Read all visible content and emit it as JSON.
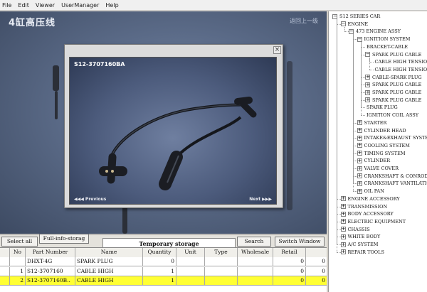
{
  "menu": [
    "File",
    "Edit",
    "Viewer",
    "UserManager",
    "Help"
  ],
  "viewer": {
    "title": "4缸高压线",
    "back_label": "返回上一级"
  },
  "popup": {
    "part_no": "S12-3707160BA",
    "prev_label": "◀◀◀ Previous",
    "next_label": "Next ▶▶▶",
    "close": "×"
  },
  "toolbar": {
    "select_all": "Select all",
    "full_info": "Full-info-storag",
    "storage_tab": "Temporary storage",
    "search": "Search",
    "switch_window": "Switch Window"
  },
  "table": {
    "headers": [
      "No",
      "Part Number",
      "Name",
      "Quantity",
      "Unit",
      "Type",
      "Wholesale",
      "Retail"
    ],
    "rows": [
      {
        "no": "",
        "part": "DHXT-4G",
        "name": "SPARK PLUG",
        "qty": "0",
        "unit": "",
        "type": "",
        "wholesale": "",
        "retail": "0"
      },
      {
        "no": "1",
        "part": "S12-3707160",
        "name": "CABLE HIGH",
        "qty": "1",
        "unit": "",
        "type": "",
        "wholesale": "",
        "retail": "0"
      },
      {
        "no": "2",
        "part": "S12-3707160B..",
        "name": "CABLE HIGH",
        "qty": "1",
        "unit": "",
        "type": "",
        "wholesale": "",
        "retail": "0"
      }
    ]
  },
  "tree": [
    {
      "label": "S12 SERIES CAR",
      "level": 0,
      "box": "−"
    },
    {
      "label": "ENGINE",
      "level": 1,
      "box": "−"
    },
    {
      "label": "473 ENGINE ASSY",
      "level": 2,
      "box": "−"
    },
    {
      "label": "IGNITION SYSTEM",
      "level": 3,
      "box": "−"
    },
    {
      "label": "BRACKET-CABLE",
      "level": 4,
      "box": ""
    },
    {
      "label": "SPARK PLUG CABLE",
      "level": 4,
      "box": "−"
    },
    {
      "label": "CABLE HIGH TENSION",
      "level": 5,
      "box": ""
    },
    {
      "label": "CABLE HIGH TENSION",
      "level": 5,
      "box": ""
    },
    {
      "label": "CABLE-SPARK PLUG",
      "level": 4,
      "box": "+"
    },
    {
      "label": "SPARK PLUG CABLE",
      "level": 4,
      "box": "+"
    },
    {
      "label": "SPARK PLUG CABLE",
      "level": 4,
      "box": "+"
    },
    {
      "label": "SPARK PLUG CABLE",
      "level": 4,
      "box": "+"
    },
    {
      "label": "SPARK PLUG",
      "level": 4,
      "box": ""
    },
    {
      "label": "IGNITION COIL ASSY",
      "level": 4,
      "box": ""
    },
    {
      "label": "STARTER",
      "level": 3,
      "box": "+"
    },
    {
      "label": "CYLINDER HEAD",
      "level": 3,
      "box": "+"
    },
    {
      "label": "INTAKE&EXHAUST SYSTEM",
      "level": 3,
      "box": "+"
    },
    {
      "label": "COOLING SYSTEM",
      "level": 3,
      "box": "+"
    },
    {
      "label": "TIMING SYSTEM",
      "level": 3,
      "box": "+"
    },
    {
      "label": "CYLINDER",
      "level": 3,
      "box": "+"
    },
    {
      "label": "VALVE COVER",
      "level": 3,
      "box": "+"
    },
    {
      "label": "CRANKSHAFT & CONROD",
      "level": 3,
      "box": "+"
    },
    {
      "label": "CRANKSHAFT VANTILATION",
      "level": 3,
      "box": "+"
    },
    {
      "label": "OIL PAN",
      "level": 3,
      "box": "+"
    },
    {
      "label": "ENGINE ACCESSORY",
      "level": 1,
      "box": "+"
    },
    {
      "label": "TRANSMISSION",
      "level": 1,
      "box": "+"
    },
    {
      "label": "BODY ACCESSORY",
      "level": 1,
      "box": "+"
    },
    {
      "label": "ELECTRIC EQUIPMENT",
      "level": 1,
      "box": "+"
    },
    {
      "label": "CHASSIS",
      "level": 1,
      "box": "+"
    },
    {
      "label": "WHITE BODY",
      "level": 1,
      "box": "+"
    },
    {
      "label": "A/C SYSTEM",
      "level": 1,
      "box": "+"
    },
    {
      "label": "REPAIR TOOLS",
      "level": 1,
      "box": "+"
    }
  ]
}
